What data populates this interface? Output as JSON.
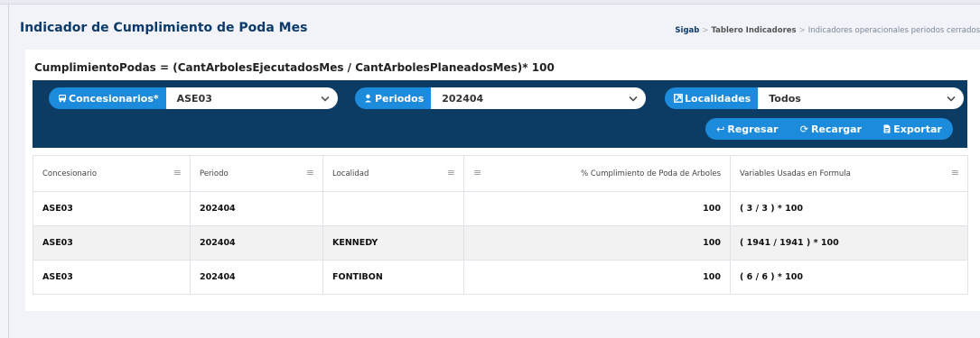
{
  "header": {
    "title": "Indicador de Cumplimiento de Poda Mes",
    "breadcrumb": [
      "Sigab",
      "Tablero Indicadores",
      "Indicadores operacionales periodos cerrados"
    ]
  },
  "formula": "CumplimientoPodas = (CantArbolesEjecutadosMes / CantArbolesPlaneadosMes)* 100",
  "filters": {
    "concesionarios": {
      "label": "Concesionarios*",
      "value": "ASE03",
      "icon": "bus-icon"
    },
    "periodos": {
      "label": "Periodos",
      "value": "202404",
      "icon": "person-pin-icon"
    },
    "localidades": {
      "label": "Localidades",
      "value": "Todos",
      "icon": "map-square-icon"
    }
  },
  "actions": {
    "regresar": "Regresar",
    "recargar": "Recargar",
    "exportar": "Exportar"
  },
  "table": {
    "columns": [
      "Concesionario",
      "Periodo",
      "Localidad",
      "% Cumplimiento de Poda de Arboles",
      "Variables Usadas en Formula"
    ],
    "rows": [
      [
        "ASE03",
        "202404",
        "",
        "100",
        "( 3 / 3 ) * 100"
      ],
      [
        "ASE03",
        "202404",
        "KENNEDY",
        "100",
        "( 1941 / 1941 ) * 100"
      ],
      [
        "ASE03",
        "202404",
        "FONTIBON",
        "100",
        "( 6 / 6 ) * 100"
      ]
    ]
  },
  "colors": {
    "primary_dark": "#0c3b63",
    "accent_blue": "#1d8bdc",
    "title_blue": "#0c3a6b"
  }
}
